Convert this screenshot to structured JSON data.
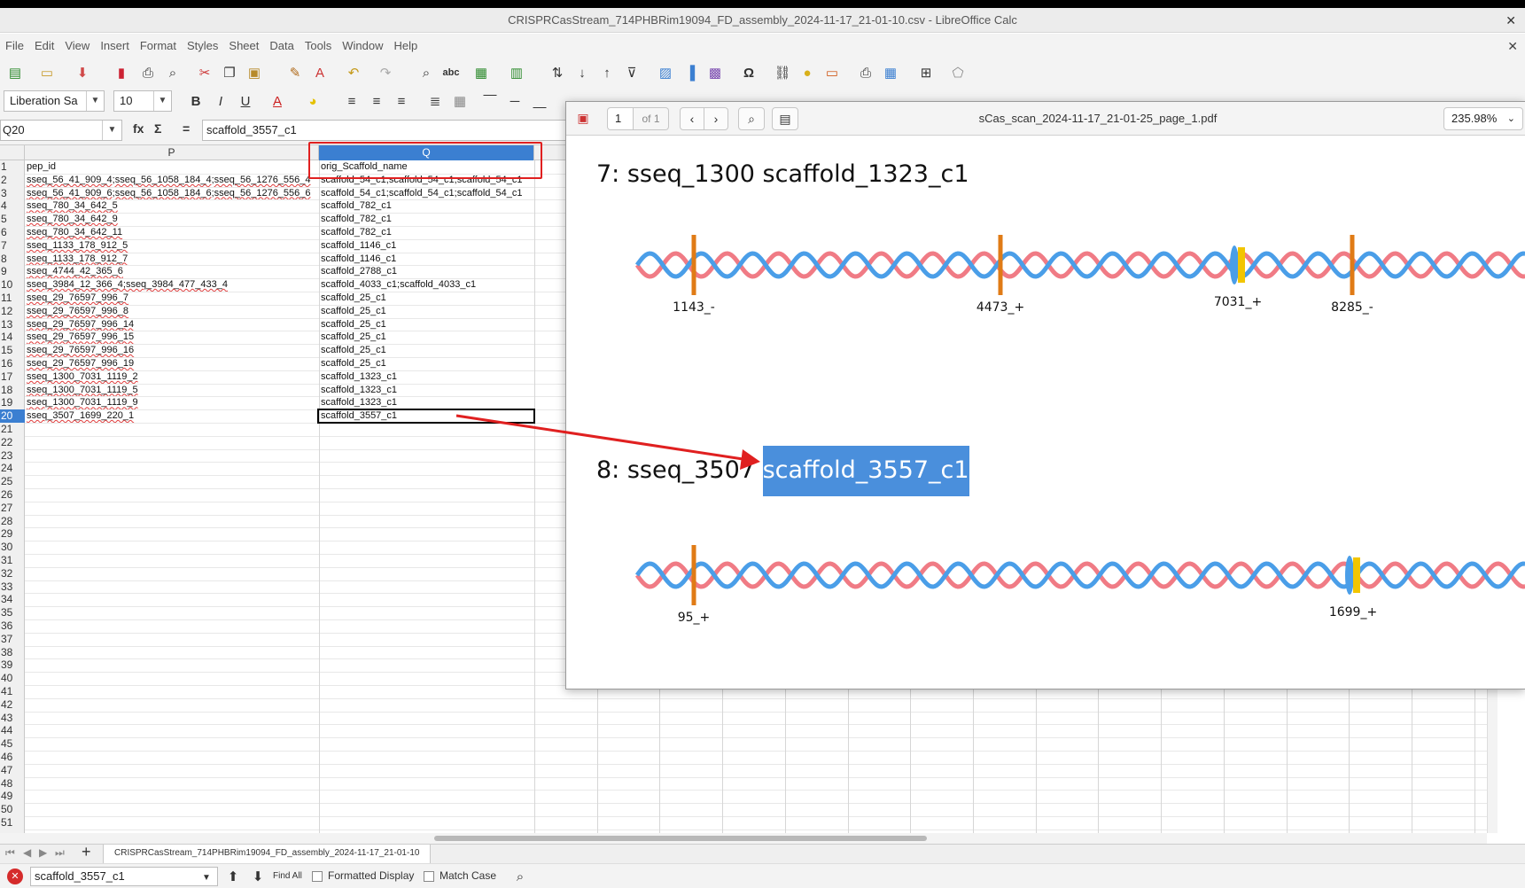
{
  "window": {
    "title": "CRISPRCasStream_714PHBRim19094_FD_assembly_2024-11-17_21-01-10.csv - LibreOffice Calc"
  },
  "menu": [
    "File",
    "Edit",
    "View",
    "Insert",
    "Format",
    "Styles",
    "Sheet",
    "Data",
    "Tools",
    "Window",
    "Help"
  ],
  "format_bar": {
    "font_name": "Liberation Sa",
    "font_size": "10"
  },
  "formula_bar": {
    "cell_ref": "Q20",
    "content": "scaffold_3557_c1"
  },
  "sheet": {
    "columns": [
      "P",
      "Q"
    ],
    "selected_column": "Q",
    "active_row": "20",
    "row_numbers": [
      "1",
      "2",
      "3",
      "4",
      "5",
      "6",
      "7",
      "8",
      "9",
      "10",
      "11",
      "12",
      "13",
      "14",
      "15",
      "16",
      "17",
      "18",
      "19",
      "20",
      "21",
      "22",
      "23",
      "24",
      "25",
      "26",
      "27",
      "28",
      "29",
      "30",
      "31",
      "32",
      "33",
      "34",
      "35",
      "36",
      "37",
      "38",
      "39",
      "40",
      "41",
      "42",
      "43",
      "44",
      "45",
      "46",
      "47",
      "48",
      "49",
      "50",
      "51"
    ],
    "rows": [
      {
        "p": "pep_id",
        "q": "orig_Scaffold_name"
      },
      {
        "p": "sseq_56_41_909_4;sseq_56_1058_184_4;sseq_56_1276_556_4",
        "q": "scaffold_54_c1;scaffold_54_c1;scaffold_54_c1"
      },
      {
        "p": "sseq_56_41_909_6;sseq_56_1058_184_6;sseq_56_1276_556_6",
        "q": "scaffold_54_c1;scaffold_54_c1;scaffold_54_c1"
      },
      {
        "p": "sseq_780_34_642_5",
        "q": "scaffold_782_c1"
      },
      {
        "p": "sseq_780_34_642_9",
        "q": "scaffold_782_c1"
      },
      {
        "p": "sseq_780_34_642_11",
        "q": "scaffold_782_c1"
      },
      {
        "p": "sseq_1133_178_912_5",
        "q": "scaffold_1146_c1"
      },
      {
        "p": "sseq_1133_178_912_7",
        "q": "scaffold_1146_c1"
      },
      {
        "p": "sseq_4744_42_365_6",
        "q": "scaffold_2788_c1"
      },
      {
        "p": "sseq_3984_12_366_4;sseq_3984_477_433_4",
        "q": "scaffold_4033_c1;scaffold_4033_c1"
      },
      {
        "p": "sseq_29_76597_996_7",
        "q": "scaffold_25_c1"
      },
      {
        "p": "sseq_29_76597_996_8",
        "q": "scaffold_25_c1"
      },
      {
        "p": "sseq_29_76597_996_14",
        "q": "scaffold_25_c1"
      },
      {
        "p": "sseq_29_76597_996_15",
        "q": "scaffold_25_c1"
      },
      {
        "p": "sseq_29_76597_996_16",
        "q": "scaffold_25_c1"
      },
      {
        "p": "sseq_29_76597_996_19",
        "q": "scaffold_25_c1"
      },
      {
        "p": "sseq_1300_7031_1119_2",
        "q": "scaffold_1323_c1"
      },
      {
        "p": "sseq_1300_7031_1119_5",
        "q": "scaffold_1323_c1"
      },
      {
        "p": "sseq_1300_7031_1119_9",
        "q": "scaffold_1323_c1"
      },
      {
        "p": "sseq_3507_1699_220_1",
        "q": "scaffold_3557_c1"
      }
    ],
    "tab_name": "CRISPRCasStream_714PHBRim19094_FD_assembly_2024-11-17_21-01-10"
  },
  "find_bar": {
    "query": "scaffold_3557_c1",
    "find_all": "Find All",
    "formatted_display": "Formatted Display",
    "match_case": "Match Case"
  },
  "viewer": {
    "title": "sCas_scan_2024-11-17_21-01-25_page_1.pdf",
    "page": "1",
    "page_of": "of 1",
    "zoom": "235.98%",
    "entries": [
      {
        "prefix": "7: sseq_1300 scaffold_1323_c1",
        "labels": [
          "1143_-",
          "4473_+",
          "7031_+",
          "8285_-"
        ]
      },
      {
        "prefix": "8: sseq_3507",
        "highlight": "scaffold_3557_c1",
        "labels": [
          "95_+",
          "1699_+"
        ]
      }
    ]
  },
  "colors": {
    "accent": "#3b7fd1",
    "annotation": "#e02020",
    "strand_a": "#f07b85",
    "strand_b": "#4a9ee8",
    "marker": "#e07b16",
    "marker_yellow": "#f2c500"
  }
}
